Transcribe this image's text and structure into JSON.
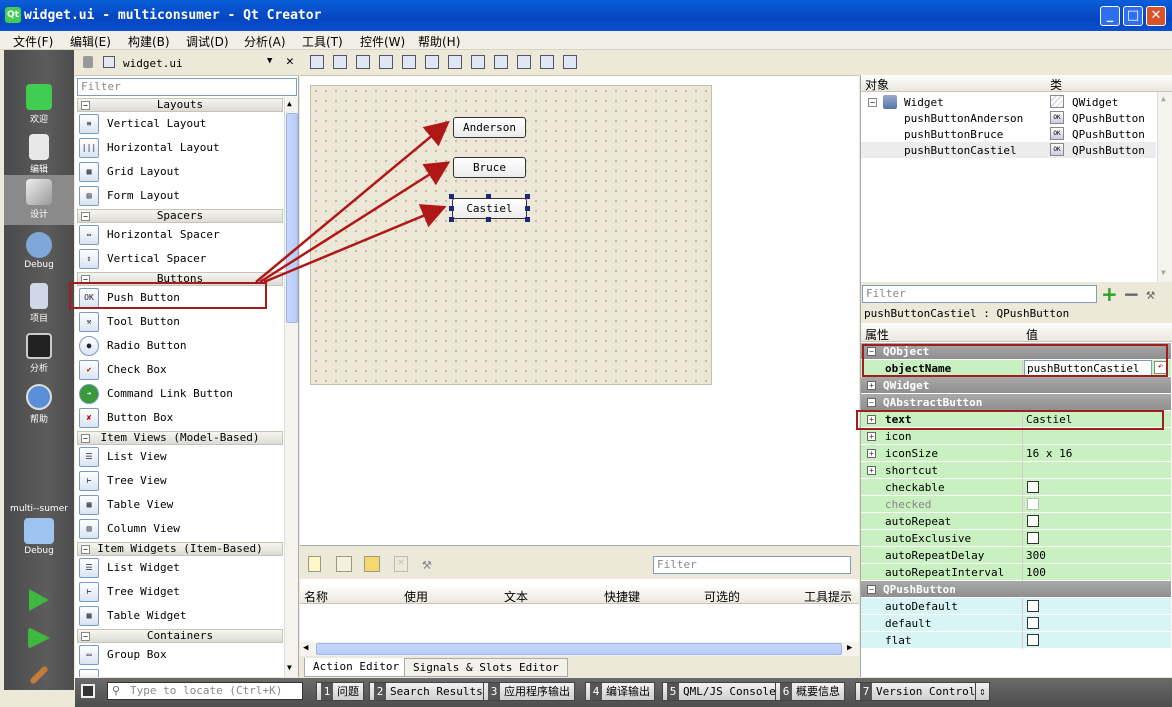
{
  "window": {
    "title": "widget.ui - multiconsumer - Qt Creator",
    "min": "_",
    "max": "□",
    "close": "✕"
  },
  "menu": [
    "文件(F)",
    "编辑(E)",
    "构建(B)",
    "调试(D)",
    "分析(A)",
    "工具(T)",
    "控件(W)",
    "帮助(H)"
  ],
  "modes": [
    {
      "label": "欢迎",
      "icon": "welcome-icon"
    },
    {
      "label": "编辑",
      "icon": "edit-icon"
    },
    {
      "label": "设计",
      "icon": "design-icon"
    },
    {
      "label": "Debug",
      "icon": "debug-icon"
    },
    {
      "label": "项目",
      "icon": "projects-icon"
    },
    {
      "label": "分析",
      "icon": "analyze-icon"
    },
    {
      "label": "帮助",
      "icon": "help-icon"
    }
  ],
  "target": {
    "project": "multi--sumer",
    "mode": "Debug"
  },
  "editor": {
    "file": "widget.ui"
  },
  "widgetbox": {
    "filter_placeholder": "Filter",
    "categories": {
      "layouts": "Layouts",
      "spacers": "Spacers",
      "buttons": "Buttons",
      "item_views": "Item Views (Model-Based)",
      "item_widgets": "Item Widgets (Item-Based)",
      "containers": "Containers"
    },
    "items": {
      "vertical_layout": "Vertical Layout",
      "horizontal_layout": "Horizontal Layout",
      "grid_layout": "Grid Layout",
      "form_layout": "Form Layout",
      "horizontal_spacer": "Horizontal Spacer",
      "vertical_spacer": "Vertical Spacer",
      "push_button": "Push Button",
      "tool_button": "Tool Button",
      "radio_button": "Radio Button",
      "check_box": "Check Box",
      "command_link_button": "Command Link Button",
      "button_box": "Button Box",
      "list_view": "List View",
      "tree_view": "Tree View",
      "table_view": "Table View",
      "column_view": "Column View",
      "list_widget": "List Widget",
      "tree_widget": "Tree Widget",
      "table_widget": "Table Widget",
      "group_box": "Group Box"
    }
  },
  "form": {
    "buttons": {
      "anderson": "Anderson",
      "bruce": "Bruce",
      "castiel": "Castiel"
    }
  },
  "action_editor": {
    "filter_placeholder": "Filter",
    "columns": [
      "名称",
      "使用",
      "文本",
      "快捷键",
      "可选的",
      "工具提示"
    ],
    "tabs": [
      "Action Editor",
      "Signals & Slots Editor"
    ]
  },
  "object_inspector": {
    "columns": [
      "对象",
      "类"
    ],
    "rows": [
      {
        "name": "Widget",
        "class": "QWidget"
      },
      {
        "name": "pushButtonAnderson",
        "class": "QPushButton"
      },
      {
        "name": "pushButtonBruce",
        "class": "QPushButton"
      },
      {
        "name": "pushButtonCastiel",
        "class": "QPushButton"
      }
    ]
  },
  "property_editor": {
    "filter_placeholder": "Filter",
    "selection": "pushButtonCastiel : QPushButton",
    "columns": [
      "属性",
      "值"
    ],
    "rows": [
      {
        "kind": "group",
        "name": "QObject"
      },
      {
        "kind": "prop",
        "name": "objectName",
        "value": "pushButtonCastiel",
        "bold": true
      },
      {
        "kind": "group",
        "name": "QWidget",
        "collapsed": true
      },
      {
        "kind": "group",
        "name": "QAbstractButton"
      },
      {
        "kind": "prop",
        "name": "text",
        "value": "Castiel",
        "bold": true,
        "exp": true
      },
      {
        "kind": "prop",
        "name": "icon",
        "value": "",
        "exp": true
      },
      {
        "kind": "prop",
        "name": "iconSize",
        "value": "16 x 16",
        "exp": true
      },
      {
        "kind": "prop",
        "name": "shortcut",
        "value": "",
        "exp": true
      },
      {
        "kind": "prop",
        "name": "checkable",
        "checkbox": true
      },
      {
        "kind": "prop",
        "name": "checked",
        "checkbox": true,
        "disabled": true
      },
      {
        "kind": "prop",
        "name": "autoRepeat",
        "checkbox": true
      },
      {
        "kind": "prop",
        "name": "autoExclusive",
        "checkbox": true
      },
      {
        "kind": "prop",
        "name": "autoRepeatDelay",
        "value": "300"
      },
      {
        "kind": "prop",
        "name": "autoRepeatInterval",
        "value": "100"
      },
      {
        "kind": "group",
        "name": "QPushButton"
      },
      {
        "kind": "prop",
        "name": "autoDefault",
        "checkbox": true,
        "alt": true
      },
      {
        "kind": "prop",
        "name": "default",
        "checkbox": true,
        "alt": true
      },
      {
        "kind": "prop",
        "name": "flat",
        "checkbox": true,
        "alt": true
      }
    ]
  },
  "statusbar": {
    "locate_placeholder": "Type to locate (Ctrl+K)",
    "tabs": [
      {
        "n": "1",
        "label": "问题"
      },
      {
        "n": "2",
        "label": "Search Results"
      },
      {
        "n": "3",
        "label": "应用程序输出"
      },
      {
        "n": "4",
        "label": "编译输出"
      },
      {
        "n": "5",
        "label": "QML/JS Console"
      },
      {
        "n": "6",
        "label": "概要信息"
      },
      {
        "n": "7",
        "label": "Version Control"
      }
    ]
  },
  "colors": {
    "highlight": "#a11e1e",
    "prop_green": "#c8f0c0",
    "prop_cyan": "#d8f4f4"
  }
}
